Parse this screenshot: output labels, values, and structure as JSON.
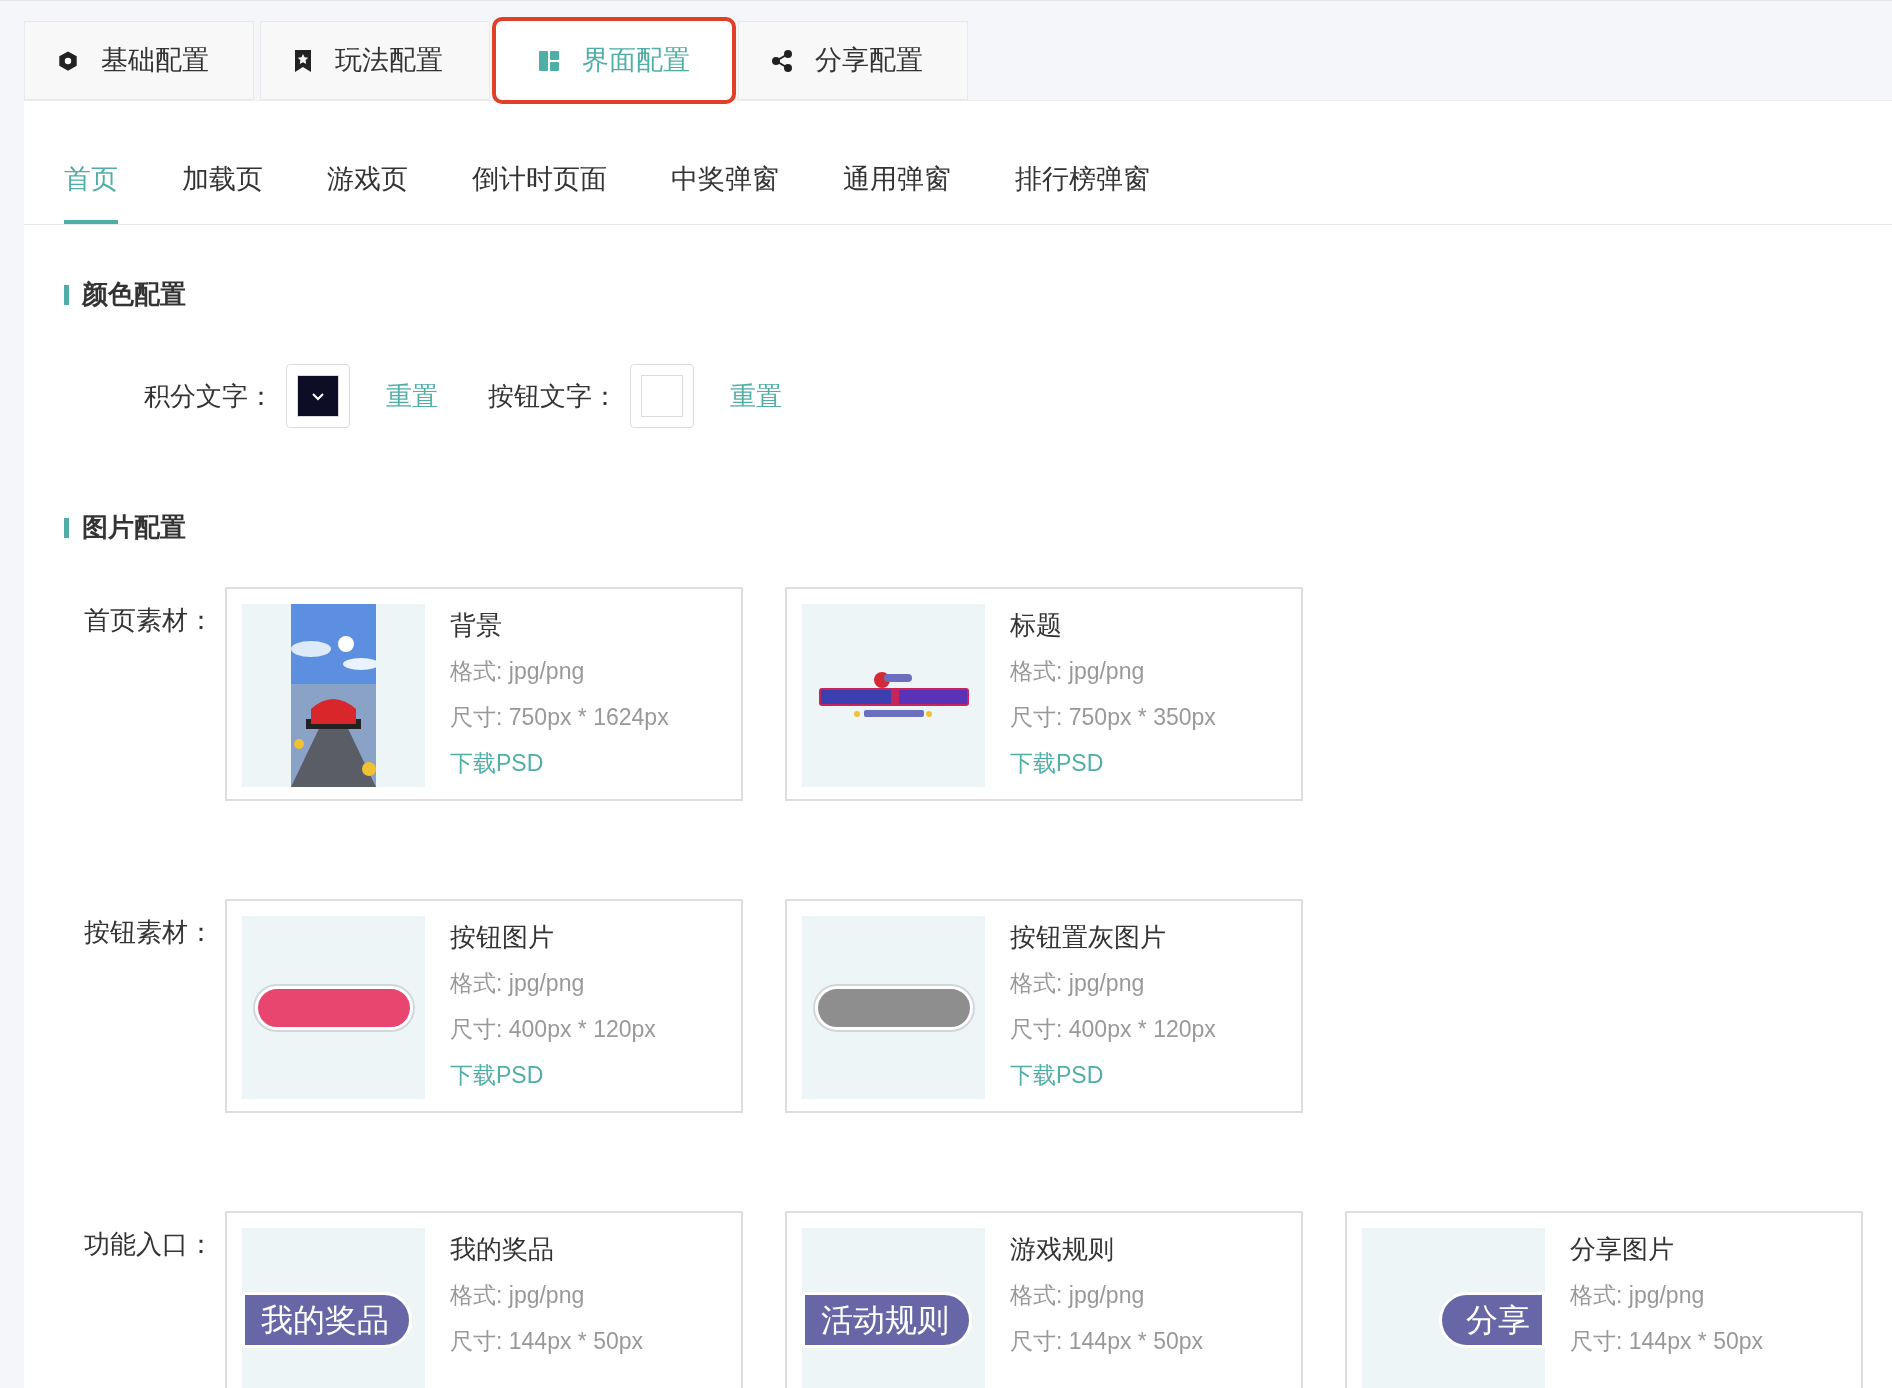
{
  "top_tabs": [
    {
      "label": "基础配置",
      "selected": false
    },
    {
      "label": "玩法配置",
      "selected": false
    },
    {
      "label": "界面配置",
      "selected": true
    },
    {
      "label": "分享配置",
      "selected": false
    }
  ],
  "sub_tabs": [
    {
      "label": "首页",
      "selected": true
    },
    {
      "label": "加载页",
      "selected": false
    },
    {
      "label": "游戏页",
      "selected": false
    },
    {
      "label": "倒计时页面",
      "selected": false
    },
    {
      "label": "中奖弹窗",
      "selected": false
    },
    {
      "label": "通用弹窗",
      "selected": false
    },
    {
      "label": "排行榜弹窗",
      "selected": false
    }
  ],
  "color_section": {
    "title": "颜色配置",
    "fields": [
      {
        "label": "积分文字：",
        "color": "#0d0e26",
        "reset": "重置"
      },
      {
        "label": "按钮文字：",
        "color": "#ffffff",
        "reset": "重置"
      }
    ]
  },
  "image_section": {
    "title": "图片配置",
    "rows": [
      {
        "label": "首页素材：",
        "items": [
          {
            "title": "背景",
            "format": "格式: jpg/png",
            "size": "尺寸: 750px * 1624px",
            "link": "下载PSD"
          },
          {
            "title": "标题",
            "format": "格式: jpg/png",
            "size": "尺寸: 750px * 350px",
            "link": "下载PSD",
            "thumb": {
              "kind": "title_art"
            }
          }
        ]
      },
      {
        "label": "按钮素材：",
        "items": [
          {
            "title": "按钮图片",
            "format": "格式: jpg/png",
            "size": "尺寸: 400px * 120px",
            "link": "下载PSD",
            "thumb": {
              "kind": "pill",
              "color": "#e8456f"
            }
          },
          {
            "title": "按钮置灰图片",
            "format": "格式: jpg/png",
            "size": "尺寸: 400px * 120px",
            "link": "下载PSD",
            "thumb": {
              "kind": "pill",
              "color": "#8e8e8e"
            }
          }
        ]
      },
      {
        "label": "功能入口：",
        "items": [
          {
            "title": "我的奖品",
            "format": "格式: jpg/png",
            "size": "尺寸: 144px * 50px",
            "thumb": {
              "kind": "tag",
              "color": "#6767a8",
              "text": "我的奖品"
            }
          },
          {
            "title": "游戏规则",
            "format": "格式: jpg/png",
            "size": "尺寸: 144px * 50px",
            "thumb": {
              "kind": "tag",
              "color": "#6767a8",
              "text": "活动规则"
            }
          },
          {
            "title": "分享图片",
            "format": "格式: jpg/png",
            "size": "尺寸: 144px * 50px",
            "thumb": {
              "kind": "side_tag",
              "color": "#6767a8",
              "text": "分享"
            }
          }
        ]
      }
    ]
  }
}
